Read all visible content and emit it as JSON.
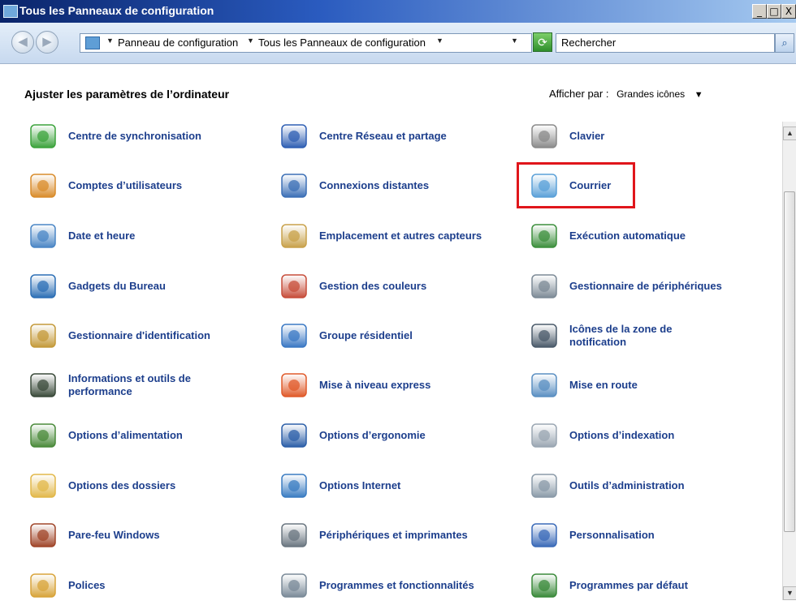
{
  "window": {
    "title": "Tous les Panneaux de configuration",
    "buttons": {
      "minimize": "_",
      "maximize": "□",
      "close": "X"
    }
  },
  "address": {
    "crumbs": [
      "Panneau de configuration",
      "Tous les Panneaux de configuration"
    ],
    "search_placeholder": "Rechercher"
  },
  "header": {
    "title": "Ajuster les paramètres de l’ordinateur",
    "view_by_label": "Afficher par :",
    "view_by_value": "Grandes icônes"
  },
  "items": [
    {
      "label": "Centre de synchronisation",
      "icon": "sync-center-icon",
      "color": "#3ca33c"
    },
    {
      "label": "Centre Réseau et partage",
      "icon": "network-icon",
      "color": "#2f5fb3"
    },
    {
      "label": "Clavier",
      "icon": "keyboard-icon",
      "color": "#8a8a8a"
    },
    {
      "label": "Comptes d’utilisateurs",
      "icon": "users-icon",
      "color": "#d98c2b"
    },
    {
      "label": "Connexions distantes",
      "icon": "remote-connections-icon",
      "color": "#3b6fb6"
    },
    {
      "label": "Courrier",
      "icon": "mail-icon",
      "color": "#5aa0d8"
    },
    {
      "label": "Date et heure",
      "icon": "clock-icon",
      "color": "#4a86c5"
    },
    {
      "label": "Emplacement et autres capteurs",
      "icon": "location-sensors-icon",
      "color": "#c8a14a"
    },
    {
      "label": "Exécution automatique",
      "icon": "autoplay-icon",
      "color": "#3c8f3c"
    },
    {
      "label": "Gadgets du Bureau",
      "icon": "gadgets-icon",
      "color": "#2c6fb5"
    },
    {
      "label": "Gestion des couleurs",
      "icon": "color-management-icon",
      "color": "#c74d3a"
    },
    {
      "label": "Gestionnaire de périphériques",
      "icon": "device-manager-icon",
      "color": "#7c8a96"
    },
    {
      "label": "Gestionnaire d'identification",
      "icon": "credential-manager-icon",
      "color": "#c49a3a"
    },
    {
      "label": "Groupe résidentiel",
      "icon": "homegroup-icon",
      "color": "#3a78c4"
    },
    {
      "label": "Icônes de la zone de notification",
      "icon": "notification-area-icon",
      "color": "#4a5a6a"
    },
    {
      "label": "Informations et outils de performance",
      "icon": "performance-icon",
      "color": "#3a4a3a"
    },
    {
      "label": "Mise à niveau express",
      "icon": "windows-logo-icon",
      "color": "#e05a2a"
    },
    {
      "label": "Mise en route",
      "icon": "getting-started-icon",
      "color": "#5a8fc2"
    },
    {
      "label": "Options d’alimentation",
      "icon": "power-options-icon",
      "color": "#4a8a3a"
    },
    {
      "label": "Options d’ergonomie",
      "icon": "ease-of-access-icon",
      "color": "#2c5fa8"
    },
    {
      "label": "Options d’indexation",
      "icon": "indexing-icon",
      "color": "#9aa6b2"
    },
    {
      "label": "Options des dossiers",
      "icon": "folder-options-icon",
      "color": "#e2b84a"
    },
    {
      "label": "Options Internet",
      "icon": "internet-options-icon",
      "color": "#3a7cc2"
    },
    {
      "label": "Outils d’administration",
      "icon": "admin-tools-icon",
      "color": "#8a9aa8"
    },
    {
      "label": "Pare-feu Windows",
      "icon": "firewall-icon",
      "color": "#a0462a"
    },
    {
      "label": "Périphériques et imprimantes",
      "icon": "printer-icon",
      "color": "#6a7680"
    },
    {
      "label": "Personnalisation",
      "icon": "personalization-icon",
      "color": "#3a6ab8"
    },
    {
      "label": "Polices",
      "icon": "fonts-icon",
      "color": "#d8a43a"
    },
    {
      "label": "Programmes et fonctionnalités",
      "icon": "programs-icon",
      "color": "#7a8a98"
    },
    {
      "label": "Programmes par défaut",
      "icon": "default-programs-icon",
      "color": "#3a8a3a"
    }
  ],
  "highlight_color": "#e0161b"
}
